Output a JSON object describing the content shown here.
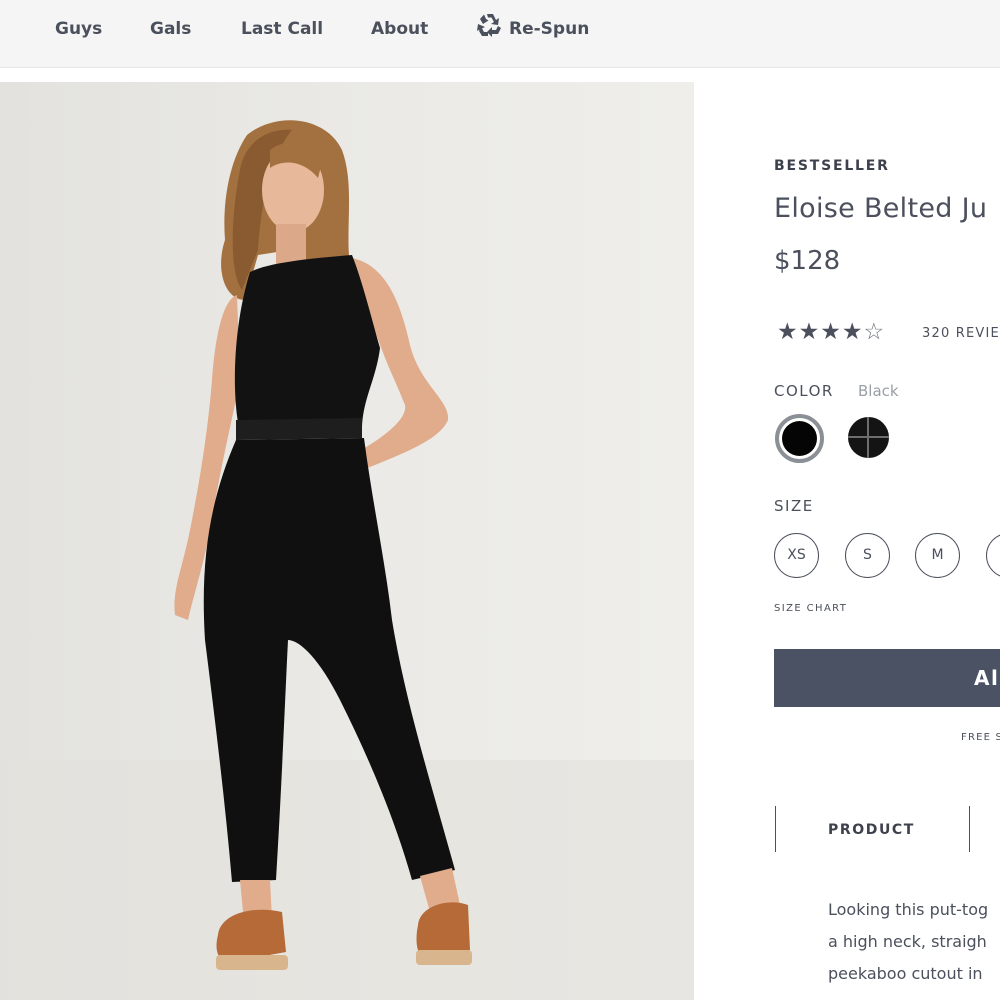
{
  "nav": {
    "items": [
      {
        "label": "Guys"
      },
      {
        "label": "Gals"
      },
      {
        "label": "Last Call"
      },
      {
        "label": "About"
      },
      {
        "label": "Re-Spun",
        "icon": "recycle-icon"
      }
    ]
  },
  "product": {
    "badge": "BESTSELLER",
    "title": "Eloise Belted Ju",
    "price": "$128",
    "rating": {
      "value": 4,
      "max": 5,
      "stars_filled": "★★★★",
      "stars_empty": "☆",
      "reviews_text": "320 REVIE"
    },
    "color": {
      "label": "COLOR",
      "selected": "Black",
      "swatches": [
        {
          "name": "Black",
          "hex": "#050505",
          "selected": true
        },
        {
          "name": "black-check",
          "hex": "#141414",
          "selected": false
        }
      ]
    },
    "size": {
      "label": "SIZE",
      "options": [
        "XS",
        "S",
        "M",
        ""
      ],
      "chart_link": "SIZE CHART"
    },
    "add_button": "Al",
    "shipping_note": "FREE S",
    "tabs": [
      {
        "label": "PRODUCT"
      }
    ],
    "description_lines": [
      "Looking this put-tog",
      "a high neck, straigh",
      "peekaboo cutout in"
    ]
  },
  "colors": {
    "accent": "#4a5264",
    "text": "#4b505c",
    "nav_bg": "#f5f5f5",
    "photo_bg": "#e8e7e3"
  }
}
